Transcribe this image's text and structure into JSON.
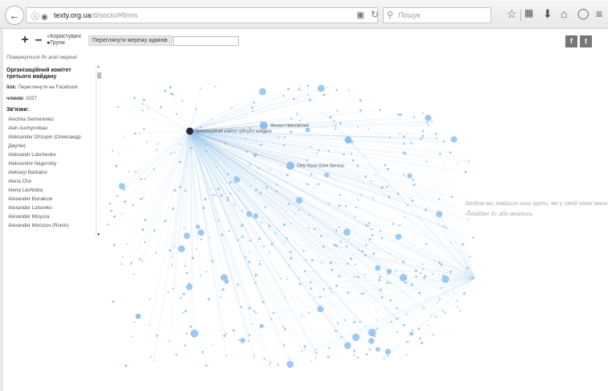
{
  "browser": {
    "url_domain": "texty.org.ua",
    "url_path": "/d/socio/#firms",
    "search_placeholder": "Пошук"
  },
  "controls": {
    "zoom_in": "+",
    "zoom_out": "–",
    "legend_users": "Користувачі",
    "legend_groups": "Групи",
    "admin_button": "Переглянути мережу адмінів",
    "admin_input_value": ""
  },
  "share": {
    "facebook": "f",
    "twitter": "t"
  },
  "panel": {
    "back_link": "Повернутися до всієї мережі",
    "group_title": "Організаційний комітет третього майдану",
    "link_label": "link:",
    "link_text": "Переглянути на Facebook",
    "members_label": "членів:",
    "members_count": "1027",
    "connections_title": "Зв'язки:",
    "connections": [
      "Alechka Semenenko",
      "Aleh Auchynnikau",
      "Aleksander Dhzupin (Олександр",
      "Джупін)",
      "Aleksandr Lubchenko",
      "Aleksandre Nagorskiy",
      "Alekseyi Barkalov",
      "Alena Che",
      "Alena Lashtoba",
      "Alexander Bunakow",
      "Alexander Lutsenko",
      "Alexander Misyura",
      "Alexander Morozov (Ronin)"
    ]
  },
  "graph": {
    "labels": {
      "hub": "Організаційний комітет третього майдану",
      "node_a": "Михаил Николаенко",
      "node_b": "Oleg Vityaz (Олег Витязь)"
    },
    "colors": {
      "user": "#8ec0ef",
      "group": "#2d2533",
      "edge": "#9cc9ee"
    }
  },
  "note": "Згодом ми знайшли інші групи, які у своїй назві мали «Майдан 3» або аналоги."
}
